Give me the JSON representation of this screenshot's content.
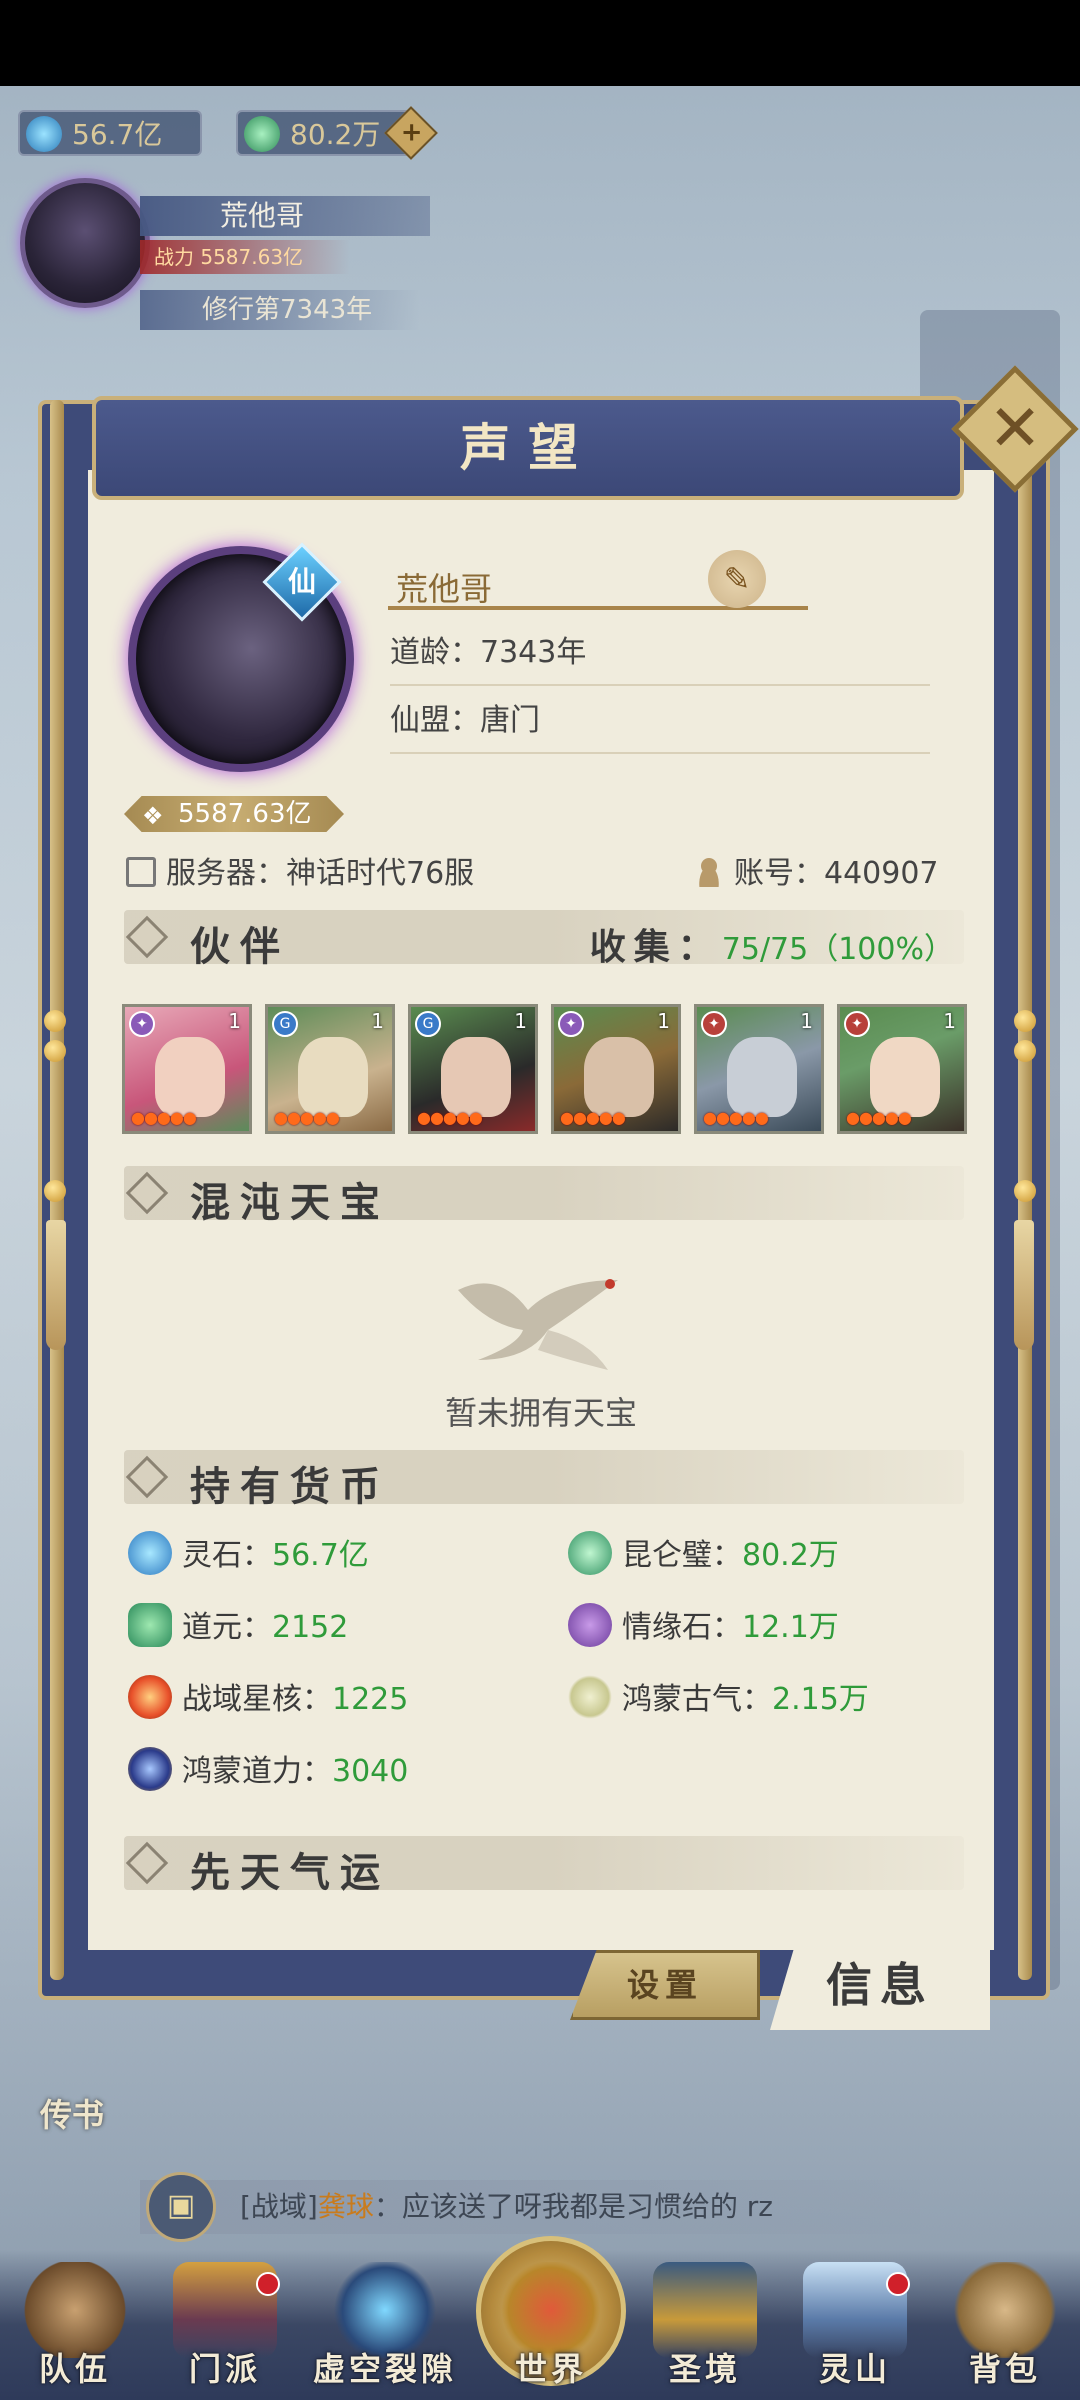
{
  "currency_top": {
    "spirit_stone": "56.7亿",
    "kunlun_jade": "80.2万",
    "add_symbol": "+"
  },
  "player": {
    "name": "荒他哥",
    "power": "战力 5587.63亿",
    "cultivation": "修行第7343年"
  },
  "dialog": {
    "title": "声望",
    "close_symbol": "✕",
    "profile": {
      "name": "荒他哥",
      "badge": "仙",
      "dao_age": "道龄：7343年",
      "alliance": "仙盟：唐门",
      "power": "5587.63亿",
      "server": "服务器：神话时代76服",
      "account": "账号：440907"
    },
    "partners": {
      "header": "伙伴",
      "collect_label": "收集：",
      "collect_value": "75/75（100%）",
      "cards": [
        {
          "level": "1",
          "elem": "✦",
          "stars": "●●●●●"
        },
        {
          "level": "1",
          "elem": "G",
          "stars": "●●●●●"
        },
        {
          "level": "1",
          "elem": "G",
          "stars": "●●●●●"
        },
        {
          "level": "1",
          "elem": "✦",
          "stars": "●●●●●"
        },
        {
          "level": "1",
          "elem": "✦",
          "stars": "●●●●●"
        },
        {
          "level": "1",
          "elem": "✦",
          "stars": "●●●●●"
        }
      ]
    },
    "treasure": {
      "header": "混沌天宝",
      "empty_text": "暂未拥有天宝"
    },
    "currencies": {
      "header": "持有货币",
      "items": [
        {
          "label": "灵石：",
          "value": "56.7亿"
        },
        {
          "label": "昆仑璧：",
          "value": "80.2万"
        },
        {
          "label": "道元：",
          "value": "2152"
        },
        {
          "label": "情缘石：",
          "value": "12.1万"
        },
        {
          "label": "战域星核：",
          "value": "1225"
        },
        {
          "label": "鸿蒙古气：",
          "value": "2.15万"
        },
        {
          "label": "鸿蒙道力：",
          "value": "3040"
        }
      ]
    },
    "next_section": "先天气运",
    "tabs": {
      "settings": "设置",
      "info": "信息"
    }
  },
  "side_button": "传书",
  "chat": {
    "channel": "[战域]",
    "user": "龚球",
    "message": "：应该送了呀我都是习惯给的  rz"
  },
  "nav": [
    {
      "label": "队伍"
    },
    {
      "label": "门派"
    },
    {
      "label": "虚空裂隙"
    },
    {
      "label": "世界"
    },
    {
      "label": "圣境"
    },
    {
      "label": "灵山"
    },
    {
      "label": "背包"
    }
  ],
  "colors": {
    "frame": "#3e4b79",
    "paper": "#f0ecdd",
    "gold": "#c9b07a",
    "value_green": "#2f9b3a"
  }
}
